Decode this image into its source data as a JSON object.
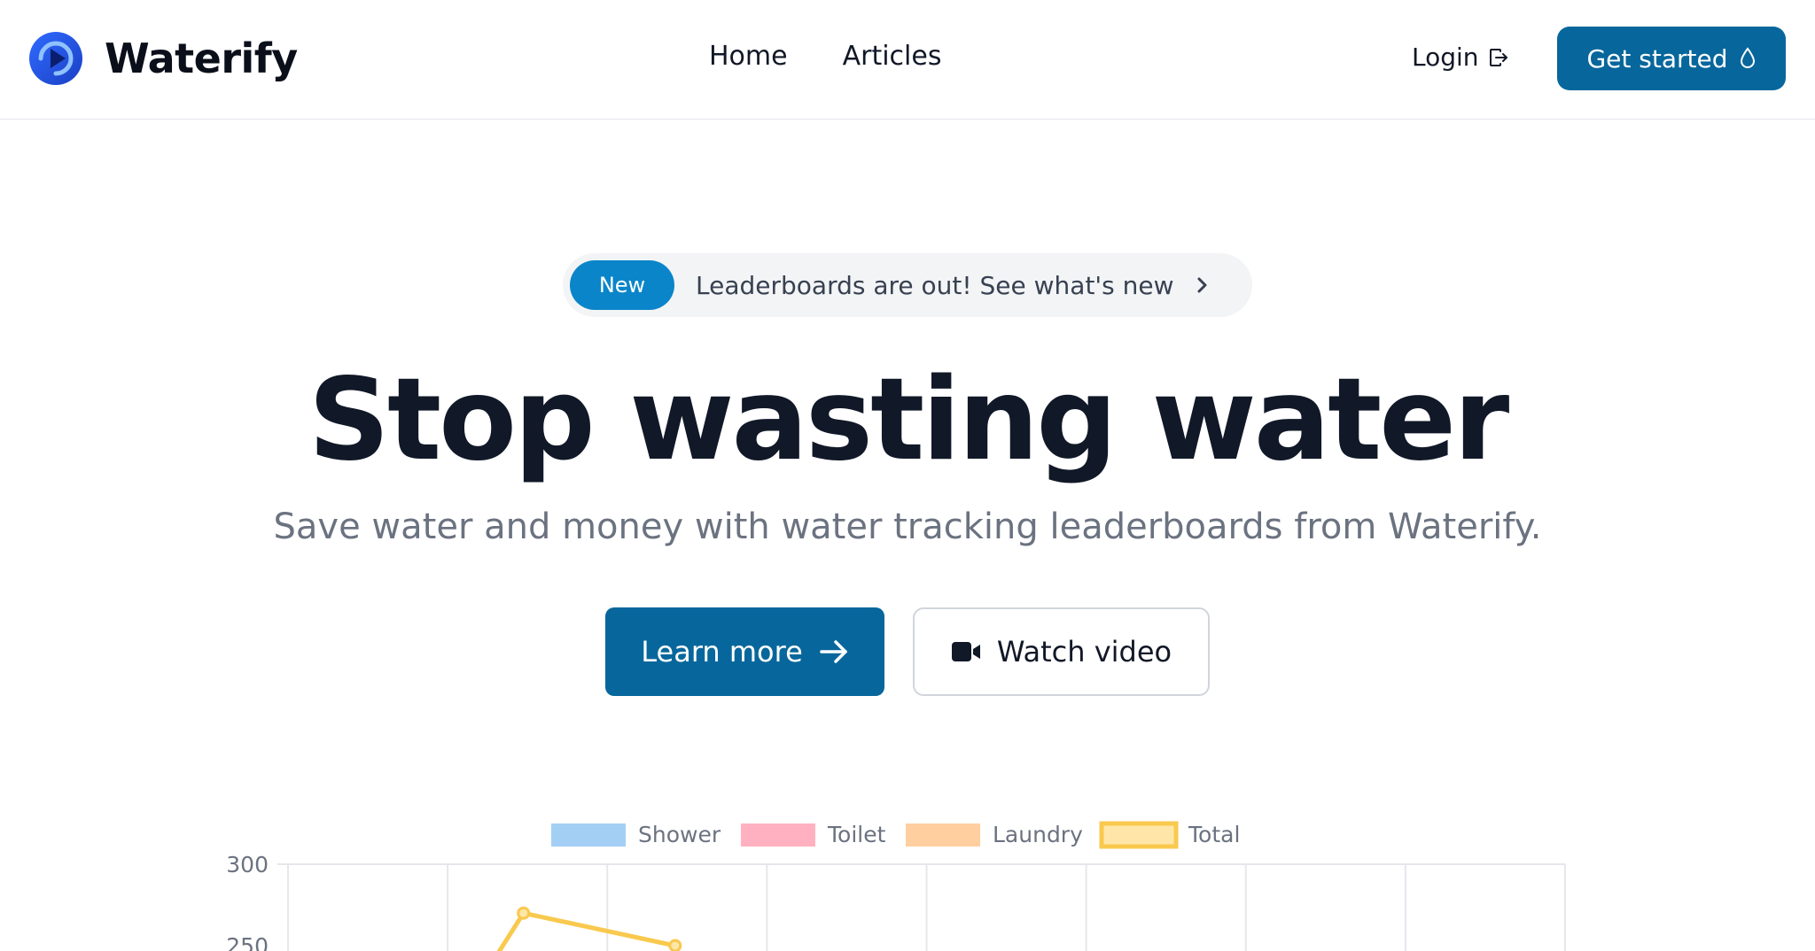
{
  "header": {
    "brand_name": "Waterify",
    "brand_color": "#1d4ed8",
    "nav": [
      {
        "label": "Home"
      },
      {
        "label": "Articles"
      }
    ],
    "login_label": "Login",
    "login_icon": "logout-arrow-icon",
    "cta_label": "Get started",
    "cta_icon": "water-drop-icon",
    "cta_color": "#07679c"
  },
  "hero": {
    "badge_label": "New",
    "announcement": "Leaderboards are out! See what's new",
    "announcement_icon": "chevron-right-icon",
    "title": "Stop wasting water",
    "subtitle": "Save water and money with water tracking leaderboards from Waterify.",
    "primary_button": "Learn more",
    "primary_icon": "arrow-right-icon",
    "secondary_button": "Watch video",
    "secondary_icon": "video-camera-icon"
  },
  "chart_data": {
    "type": "line",
    "legend_position": "top",
    "grid": true,
    "series": [
      {
        "name": "Shower",
        "color": "#a3cff5"
      },
      {
        "name": "Toilet",
        "color": "#ffb1c1"
      },
      {
        "name": "Laundry",
        "color": "#ffcf9f"
      },
      {
        "name": "Total",
        "color": "#ffe6a8",
        "border": "#f9c94e",
        "values": [
          null,
          270,
          250
        ]
      }
    ],
    "y_ticks": [
      "300",
      "250"
    ],
    "ylim": [
      0,
      300
    ],
    "x_count": 9
  }
}
